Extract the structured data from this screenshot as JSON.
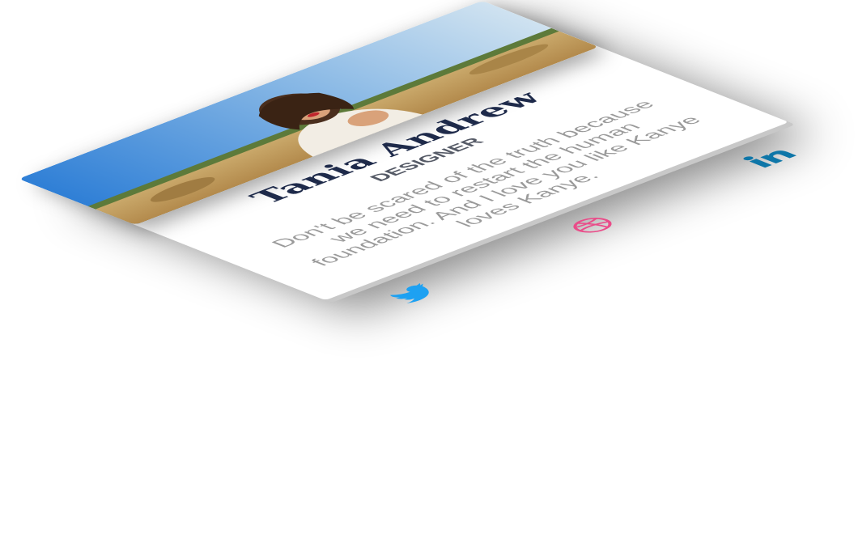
{
  "profile": {
    "name": "Tania Andrew",
    "role": "DESIGNER",
    "bio": "Don't be scared of the truth because we need to restart the human foundation. And I love you like Kanye loves Kanye."
  },
  "socials": [
    {
      "icon": "twitter-icon",
      "color": "#1da1f2"
    },
    {
      "icon": "dribbble-icon",
      "color": "#ea4c89"
    },
    {
      "icon": "linkedin-icon",
      "color": "#0e76a8"
    }
  ],
  "colors": {
    "name": "#1e2a4a",
    "role": "#555a66",
    "bio": "#9a9a9a",
    "card": "#ffffff"
  }
}
